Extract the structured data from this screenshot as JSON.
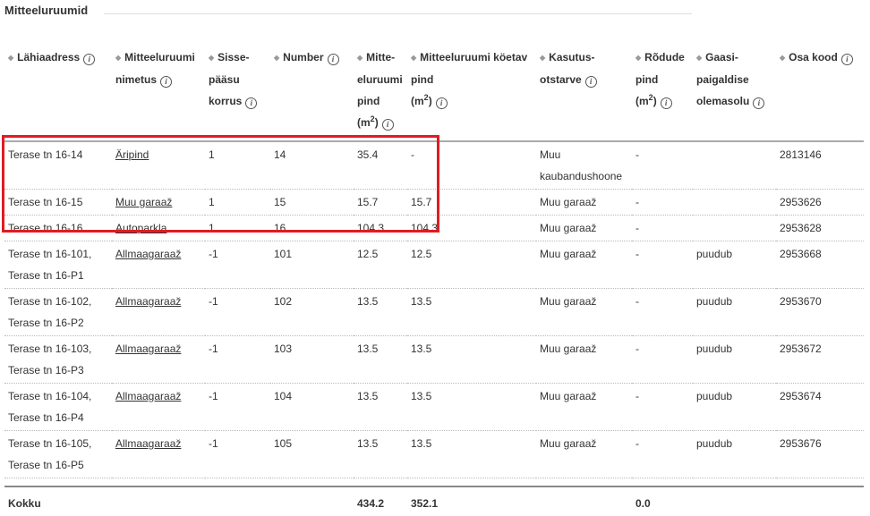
{
  "section_title": "Mitteeluruumid",
  "colors": {
    "highlight_border": "#e01b24"
  },
  "headers": [
    {
      "key": "address",
      "parts": [
        "Lähiaadress"
      ]
    },
    {
      "key": "name",
      "parts": [
        "Mitteeluruumi",
        "nimetus"
      ]
    },
    {
      "key": "floor",
      "parts": [
        "Sisse-",
        "pääsu",
        "korrus"
      ]
    },
    {
      "key": "number",
      "parts": [
        "Number"
      ]
    },
    {
      "key": "area",
      "parts": [
        "Mitte-",
        "eluruumi",
        "pind",
        "(m",
        "2",
        ")"
      ]
    },
    {
      "key": "heated",
      "parts": [
        "Mitteeluruumi köetav",
        "pind",
        "(m",
        "2",
        ")"
      ]
    },
    {
      "key": "usage",
      "parts": [
        "Kasutus-",
        "otstarve"
      ]
    },
    {
      "key": "balcony",
      "parts": [
        "Rõdude",
        "pind",
        "(m",
        "2",
        ")"
      ]
    },
    {
      "key": "gas",
      "parts": [
        "Gaasi-",
        "paigaldise",
        "olemasolu"
      ]
    },
    {
      "key": "code",
      "parts": [
        "Osa kood"
      ]
    }
  ],
  "rows": [
    {
      "address": [
        "Terase tn 16-14"
      ],
      "name": "Äripind",
      "floor": "1",
      "number": "14",
      "area": "35.4",
      "heated": "-",
      "usage": [
        "Muu",
        "kaubandushoone"
      ],
      "balcony": "-",
      "gas": "",
      "code": "2813146"
    },
    {
      "address": [
        "Terase tn 16-15"
      ],
      "name": "Muu garaaž",
      "floor": "1",
      "number": "15",
      "area": "15.7",
      "heated": "15.7",
      "usage": [
        "Muu garaaž"
      ],
      "balcony": "-",
      "gas": "",
      "code": "2953626"
    },
    {
      "address": [
        "Terase tn 16-16"
      ],
      "name": "Autoparkla",
      "floor": "1",
      "number": "16",
      "area": "104.3",
      "heated": "104.3",
      "usage": [
        "Muu garaaž"
      ],
      "balcony": "-",
      "gas": "",
      "code": "2953628"
    },
    {
      "address": [
        "Terase tn 16-101,",
        "Terase tn 16-P1"
      ],
      "name": "Allmaagaraaž",
      "floor": "-1",
      "number": "101",
      "area": "12.5",
      "heated": "12.5",
      "usage": [
        "Muu garaaž"
      ],
      "balcony": "-",
      "gas": "puudub",
      "code": "2953668"
    },
    {
      "address": [
        "Terase tn 16-102,",
        "Terase tn 16-P2"
      ],
      "name": "Allmaagaraaž",
      "floor": "-1",
      "number": "102",
      "area": "13.5",
      "heated": "13.5",
      "usage": [
        "Muu garaaž"
      ],
      "balcony": "-",
      "gas": "puudub",
      "code": "2953670"
    },
    {
      "address": [
        "Terase tn 16-103,",
        "Terase tn 16-P3"
      ],
      "name": "Allmaagaraaž",
      "floor": "-1",
      "number": "103",
      "area": "13.5",
      "heated": "13.5",
      "usage": [
        "Muu garaaž"
      ],
      "balcony": "-",
      "gas": "puudub",
      "code": "2953672"
    },
    {
      "address": [
        "Terase tn 16-104,",
        "Terase tn 16-P4"
      ],
      "name": "Allmaagaraaž",
      "floor": "-1",
      "number": "104",
      "area": "13.5",
      "heated": "13.5",
      "usage": [
        "Muu garaaž"
      ],
      "balcony": "-",
      "gas": "puudub",
      "code": "2953674"
    },
    {
      "address": [
        "Terase tn 16-105,",
        "Terase tn 16-P5"
      ],
      "name": "Allmaagaraaž",
      "floor": "-1",
      "number": "105",
      "area": "13.5",
      "heated": "13.5",
      "usage": [
        "Muu garaaž"
      ],
      "balcony": "-",
      "gas": "puudub",
      "code": "2953676"
    }
  ],
  "total": {
    "label": "Kokku",
    "area": "434.2",
    "heated": "352.1",
    "balcony": "0.0"
  }
}
